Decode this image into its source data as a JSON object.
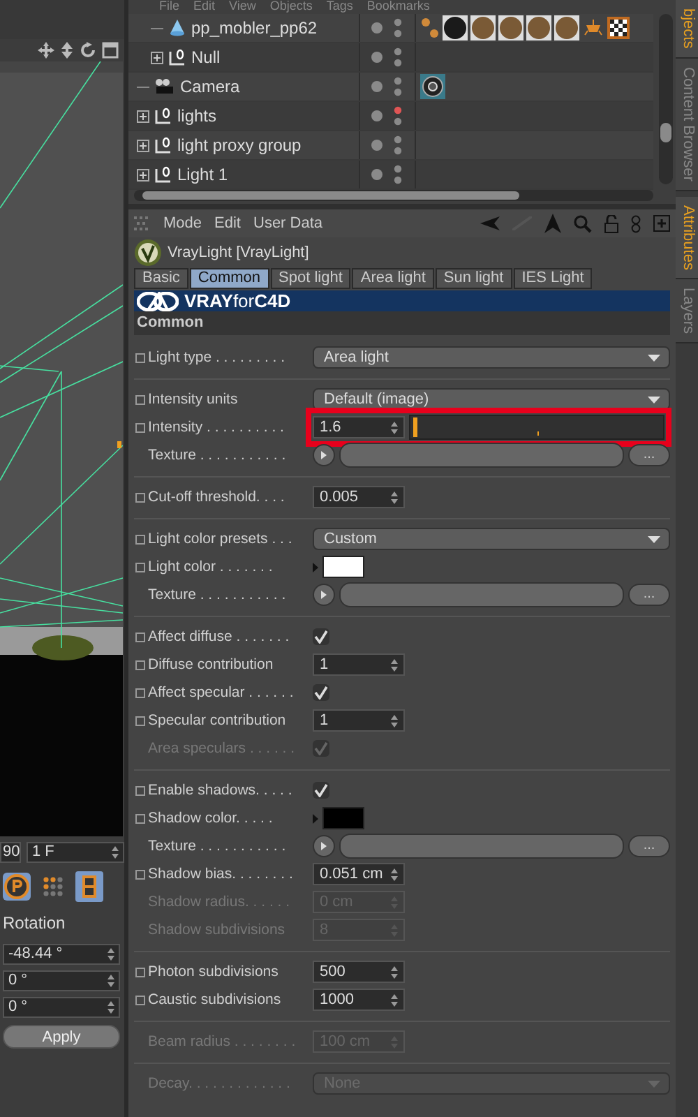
{
  "objects_menu": [
    "File",
    "Edit",
    "View",
    "Objects",
    "Tags",
    "Bookmarks"
  ],
  "objects": [
    {
      "children": [
        {
          "name": "pp_mobler_pp62",
          "kind": "polygon",
          "expandable": false,
          "color": "#8a8a8a",
          "tags": [
            {
              "kind": "phong"
            },
            {
              "kind": "material-dark"
            },
            {
              "kind": "material"
            },
            {
              "kind": "material"
            },
            {
              "kind": "material"
            },
            {
              "kind": "material"
            },
            {
              "kind": "light-tag"
            },
            {
              "kind": "checker"
            }
          ]
        },
        {
          "name": "Null",
          "kind": "null",
          "expandable": true,
          "color": "#8a8a8a"
        }
      ]
    },
    {
      "name": "Camera",
      "kind": "camera",
      "expandable": false,
      "color": "#8a8a8a",
      "tags": [
        {
          "kind": "target"
        }
      ]
    },
    {
      "name": "lights",
      "kind": "null",
      "expandable": true,
      "color": "#e05555"
    },
    {
      "name": "light proxy group",
      "kind": "null",
      "expandable": true,
      "color": "#8a8a8a"
    },
    {
      "name": "Light 1",
      "kind": "null",
      "expandable": true,
      "color": "#8a8a8a"
    }
  ],
  "attr_menu": [
    "Mode",
    "Edit",
    "User Data"
  ],
  "object_title": "VrayLight [VrayLight]",
  "tabs": [
    {
      "label": "Basic",
      "selected": false
    },
    {
      "label": "Common",
      "selected": true
    },
    {
      "label": "Spot light",
      "selected": false
    },
    {
      "label": "Area light",
      "selected": false
    },
    {
      "label": "Sun light",
      "selected": false
    },
    {
      "label": "IES Light",
      "selected": false
    }
  ],
  "banner": "**VRAY**for**C4D**",
  "section": "Common",
  "groups": [
    [
      {
        "kind": "dropdown",
        "label": "Light type . . . . . . . . .",
        "anim": true,
        "disabled": false,
        "value": "Area light"
      }
    ],
    [
      {
        "kind": "dropdown",
        "label": "Intensity units",
        "anim": true,
        "disabled": false,
        "value": "Default (image)"
      },
      {
        "kind": "slider",
        "label": "Intensity . . . . . . . . . .",
        "anim": true,
        "disabled": false,
        "value": "1.6",
        "level": 0.01,
        "highlighted": true
      },
      {
        "kind": "texture",
        "label": "Texture . . . . . . . . . . .",
        "anim": false,
        "disabled": false,
        "button": "..."
      }
    ],
    [
      {
        "kind": "number",
        "label": "Cut-off threshold. . . .",
        "anim": true,
        "disabled": false,
        "value": "0.005"
      }
    ],
    [
      {
        "kind": "dropdown",
        "label": "Light color presets . . .",
        "anim": true,
        "disabled": false,
        "value": "Custom"
      },
      {
        "kind": "color",
        "label": "Light color . . . . . . .",
        "anim": true,
        "disabled": false,
        "color": "#ffffff"
      },
      {
        "kind": "texture",
        "label": "Texture . . . . . . . . . . .",
        "anim": false,
        "disabled": false,
        "button": "..."
      }
    ],
    [
      {
        "kind": "check",
        "label": "Affect diffuse . . . . . . .",
        "anim": true,
        "disabled": false,
        "checked": true
      },
      {
        "kind": "number",
        "label": "Diffuse contribution",
        "anim": true,
        "disabled": false,
        "value": "1"
      },
      {
        "kind": "check",
        "label": "Affect specular . . . . . .",
        "anim": true,
        "disabled": false,
        "checked": true
      },
      {
        "kind": "number",
        "label": "Specular contribution",
        "anim": true,
        "disabled": false,
        "value": "1"
      },
      {
        "kind": "check",
        "label": "Area speculars . . . . . .",
        "anim": false,
        "disabled": true,
        "checked": true
      }
    ],
    [
      {
        "kind": "check",
        "label": "Enable shadows. . . . .",
        "anim": true,
        "disabled": false,
        "checked": true
      },
      {
        "kind": "color",
        "label": "Shadow color. . . . .",
        "anim": true,
        "disabled": false,
        "color": "#000000"
      },
      {
        "kind": "texture",
        "label": "Texture . . . . . . . . . . .",
        "anim": false,
        "disabled": false,
        "button": "..."
      },
      {
        "kind": "number",
        "label": "Shadow bias. . . . . . . .",
        "anim": true,
        "disabled": false,
        "value": "0.051 cm"
      },
      {
        "kind": "number",
        "label": "Shadow radius. . . . . .",
        "anim": false,
        "disabled": true,
        "value": "0 cm"
      },
      {
        "kind": "number",
        "label": "Shadow subdivisions",
        "anim": false,
        "disabled": true,
        "value": "8"
      }
    ],
    [
      {
        "kind": "number",
        "label": "Photon subdivisions",
        "anim": true,
        "disabled": false,
        "value": "500"
      },
      {
        "kind": "number",
        "label": "Caustic subdivisions",
        "anim": true,
        "disabled": false,
        "value": "1000"
      }
    ],
    [
      {
        "kind": "number",
        "label": "Beam radius . . . . . . . .",
        "anim": false,
        "disabled": true,
        "value": "100 cm"
      }
    ],
    [
      {
        "kind": "dropdown",
        "label": "Decay. . . . . . . . . . . . .",
        "anim": false,
        "disabled": true,
        "value": "None"
      }
    ]
  ],
  "timeline": {
    "end_frame": "90",
    "frame": "1 F"
  },
  "coords": {
    "title": "Rotation",
    "values": [
      "-48.44 °",
      "0 °",
      "0 °"
    ],
    "button": "Apply"
  },
  "side_tabs": [
    {
      "label": "bjects",
      "selected": true
    },
    {
      "label": "Content Browser",
      "selected": false
    },
    {
      "label": "Attributes",
      "selected": true
    },
    {
      "label": "Layers",
      "selected": false
    }
  ]
}
